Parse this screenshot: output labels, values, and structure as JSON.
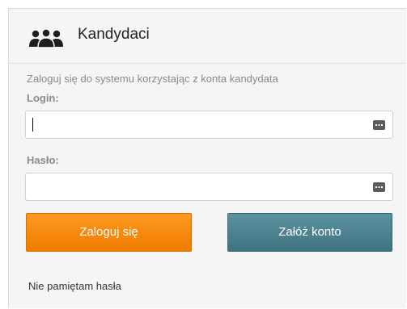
{
  "header": {
    "icon": "users-icon",
    "title": "Kandydaci"
  },
  "login_form": {
    "subtitle": "Zaloguj się do systemu korzystając z konta kandydata",
    "login_label": "Login:",
    "login_value": "",
    "password_label": "Hasło:",
    "password_value": "",
    "password_manager_icon": "password-manager-icon",
    "submit_label": "Zaloguj się",
    "register_label": "Załóż konto",
    "forgot_password_label": "Nie pamiętam hasła"
  },
  "colors": {
    "login_button": "#f58a10",
    "register_button": "#4b808e",
    "panel_background": "#f5f5f5"
  }
}
